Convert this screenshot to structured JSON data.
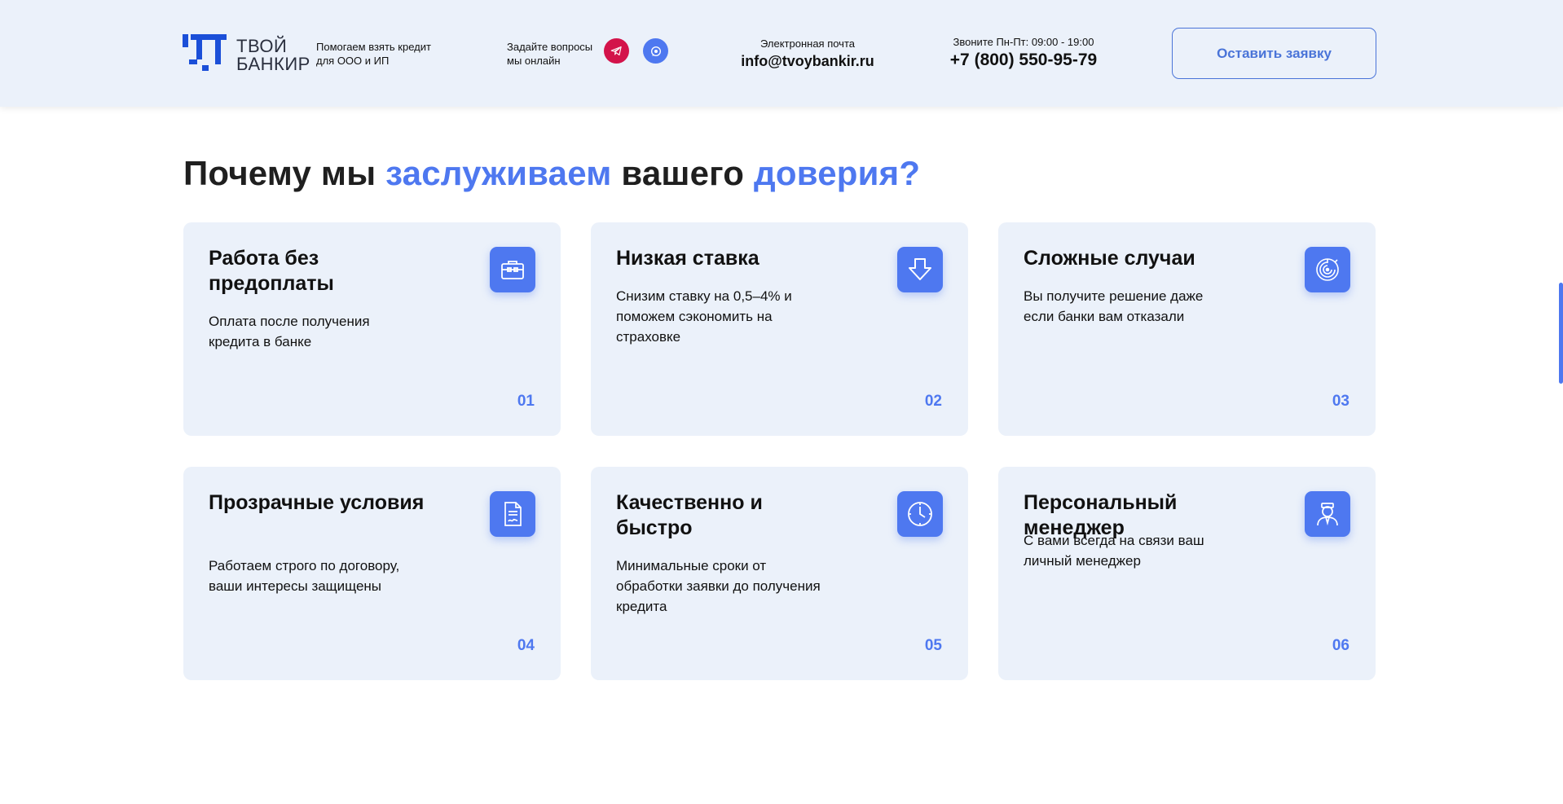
{
  "header": {
    "logo": {
      "line1": "ТВОЙ",
      "line2": "БАНКИР"
    },
    "tagline": {
      "line1": "Помогаем взять кредит",
      "line2": "для ООО и ИП"
    },
    "ask": {
      "line1": "Задайте вопросы",
      "line2": "мы онлайн"
    },
    "email": {
      "label": "Электронная почта",
      "value": "info@tvoybankir.ru"
    },
    "phone": {
      "label": "Звоните Пн-Пт: 09:00 - 19:00",
      "value": "+7 (800) 550-95-79"
    },
    "cta_label": "Оставить заявку",
    "telegram_icon": "telegram-icon",
    "whatsapp_icon": "whatsapp-icon",
    "colors": {
      "telegram": "#d3134a",
      "whatsapp": "#4e78f0",
      "accent": "#4e78f0",
      "header_bg": "#ebf1fa"
    }
  },
  "section": {
    "title_part1": "Почему мы ",
    "title_accent1": "заслуживаем",
    "title_part2": " вашего ",
    "title_accent2": "доверия?"
  },
  "cards": [
    {
      "title": "Работа без предоплаты",
      "desc": "Оплата после получения кредита в банке",
      "num": "01",
      "icon": "briefcase-icon"
    },
    {
      "title": "Низкая ставка",
      "desc": "Снизим ставку на 0,5–4% и поможем сэкономить на страховке",
      "num": "02",
      "icon": "arrow-down-icon"
    },
    {
      "title": "Сложные случаи",
      "desc": "Вы получите решение даже если банки вам отказали",
      "num": "03",
      "icon": "maze-icon"
    },
    {
      "title": "Прозрачные условия",
      "desc": "Работаем строго по договору, ваши интересы защищены",
      "num": "04",
      "icon": "contract-icon"
    },
    {
      "title": "Качественно и быстро",
      "desc": "Минимальные сроки от обработки заявки до получения кредита",
      "num": "05",
      "icon": "clock-icon"
    },
    {
      "title": "Персональный менеджер",
      "desc": "С вами всегда на связи ваш личный менеджер",
      "num": "06",
      "icon": "manager-icon"
    }
  ]
}
